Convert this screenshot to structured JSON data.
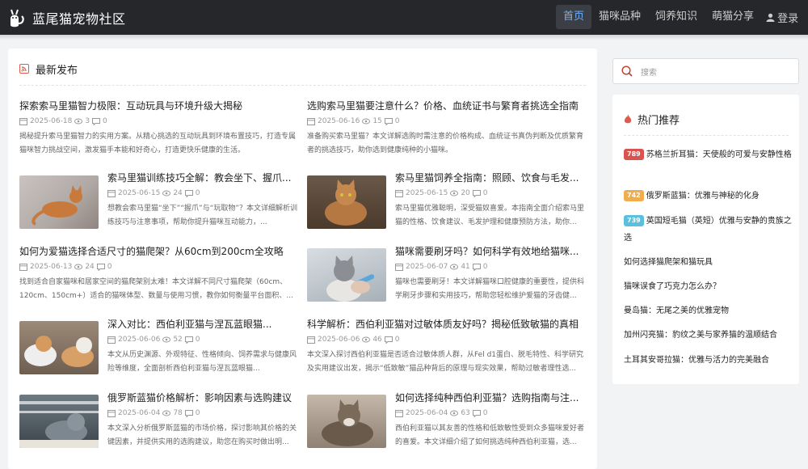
{
  "header": {
    "site_title": "蓝尾猫宠物社区",
    "nav": [
      "首页",
      "猫咪品种",
      "饲养知识",
      "萌猫分享"
    ],
    "login_label": "登录"
  },
  "main": {
    "section_title": "最新发布",
    "articles": [
      {
        "title": "探索索马里猫智力极限：互动玩具与环境升级大揭秘",
        "date": "2025-06-18",
        "views": "3",
        "comments": "0",
        "desc": "揭秘提升索马里猫智力的实用方案。从精心挑选的互动玩具到环境布置技巧，打造专属猫咪智力挑战空间，激发猫手本能和好奇心，打造更快乐健康的生活。"
      },
      {
        "title": "选购索马里猫要注意什么？价格、血统证书与繁育者挑选全指南",
        "date": "2025-06-16",
        "views": "15",
        "comments": "0",
        "desc": "准备购买索马里猫？本文详解选购时需注意的价格构成、血统证书真伪判断及优质繁育者的挑选技巧，助你选到健康纯种的小猫咪。"
      },
      {
        "title": "索马里猫训练技巧全解：教会坐下、握爪...",
        "date": "2025-06-15",
        "views": "24",
        "comments": "0",
        "desc": "想教会索马里猫“坐下”“握爪”与“玩取物”？本文详细解析训练技巧与注意事项，帮助你提升猫咪互动能力，..."
      },
      {
        "title": "索马里猫饲养全指南：照顾、饮食与毛发...",
        "date": "2025-06-15",
        "views": "20",
        "comments": "0",
        "desc": "索马里猫优雅聪明，深受猫奴喜爱。本指南全面介绍索马里猫的性格、饮食建议、毛发护理和健康预防方法，助你..."
      },
      {
        "title": "如何为爱猫选择合适尺寸的猫爬架？从60cm到200cm全攻略",
        "date": "2025-06-13",
        "views": "24",
        "comments": "0",
        "desc": "找到适合自家猫咪和居家空间的猫爬架别太难！本文详解不同尺寸猫爬架（60cm、120cm、150cm+）适合的猫咪体型、数量与使用习惯，教你如何衡量平台面积、..."
      },
      {
        "title": "猫咪需要刷牙吗？如何科学有效地给猫咪...",
        "date": "2025-06-07",
        "views": "41",
        "comments": "0",
        "desc": "猫咪也需要刷牙！本文详解猫咪口腔健康的重要性，提供科学刷牙步骤和实用技巧，帮助您轻松维护爱猫的牙齿健..."
      },
      {
        "title": "深入对比：西伯利亚猫与涅瓦蓝眼猫...",
        "date": "2025-06-06",
        "views": "52",
        "comments": "0",
        "desc": "本文从历史渊源、外观特征、性格倾向、饲养需求与健康风险等维度，全面剖析西伯利亚猫与涅瓦蓝眼猫..."
      },
      {
        "title": "科学解析：西伯利亚猫对过敏体质友好吗？揭秘低致敏猫的真相",
        "date": "2025-06-06",
        "views": "46",
        "comments": "0",
        "desc": "本文深入探讨西伯利亚猫是否适合过敏体质人群，从Fel d1蛋白、脱毛特性、科学研究及实用建议出发，揭示“低致敏”猫品种背后的原理与现实效果，帮助过敏者理性选..."
      },
      {
        "title": "俄罗斯蓝猫价格解析：影响因素与选购建议",
        "date": "2025-06-04",
        "views": "78",
        "comments": "0",
        "desc": "本文深入分析俄罗斯蓝猫的市场价格，探讨影响其价格的关键因素，并提供实用的选购建议，助您在购买时做出明..."
      },
      {
        "title": "如何选择纯种西伯利亚猫？选购指南与注...",
        "date": "2025-06-04",
        "views": "63",
        "comments": "0",
        "desc": "西伯利亚猫以其友善的性格和低致敏性受到众多猫咪爱好者的喜爱。本文详细介绍了如何挑选纯种西伯利亚猫，选..."
      }
    ]
  },
  "sidebar": {
    "search_placeholder": "搜索",
    "hot_title": "热门推荐",
    "hot_items": [
      {
        "badge": "789",
        "text": "苏格兰折耳猫：天使般的可爱与安静性格",
        "color": "#d9534f"
      },
      {
        "badge": "742",
        "text": "俄罗斯蓝猫：优雅与神秘的化身",
        "color": "#f0ad4e"
      },
      {
        "badge": "739",
        "text": "英国短毛猫（英短）优雅与安静的贵族之选",
        "color": "#5bc0de"
      },
      {
        "badge": "",
        "text": "如何选择猫爬架和猫玩具"
      },
      {
        "badge": "",
        "text": "猫咪误食了巧克力怎么办？"
      },
      {
        "badge": "",
        "text": "曼岛猫：无尾之美的优雅宠物"
      },
      {
        "badge": "",
        "text": "加州闪亮猫：豹纹之美与家养猫的温顺结合"
      },
      {
        "badge": "",
        "text": "土耳其安哥拉猫：优雅与活力的完美融合"
      }
    ]
  }
}
